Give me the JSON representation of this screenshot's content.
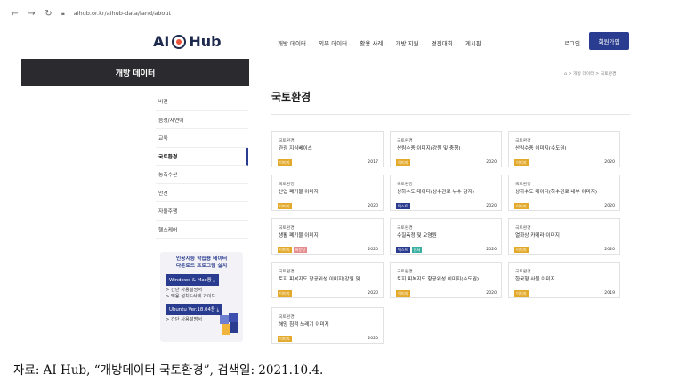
{
  "browser": {
    "url": "aihub.or.kr/aihub-data/land/about"
  },
  "header": {
    "logo_ai": "AI",
    "logo_hub": "Hub",
    "menu": [
      "개방 데이터",
      "외부 데이터",
      "활용 사례",
      "개방 지원",
      "경진대회",
      "게시판"
    ],
    "login": "로그인",
    "signup": "회원가입"
  },
  "sidebar": {
    "title": "개방 데이터",
    "items": [
      "비전",
      "음성/자연어",
      "교육",
      "국토환경",
      "농축수산",
      "안전",
      "자율주행",
      "헬스케어"
    ],
    "active_index": 3
  },
  "promo": {
    "title1": "인공지능 학습용 데이터",
    "title2": "다운로드 프로그램 설치",
    "btn1": "Windows & Mac용",
    "link1": "> 간단 사용설명서",
    "link2": "> 맥용 설치&삭제 가이드",
    "btn2": "Ubuntu Ver.18.04용",
    "link3": "> 간단 사용설명서"
  },
  "breadcrumb": "> 개방 데이터 > 국토환경",
  "page_title": "국토환경",
  "colors": {
    "tag_image": "#e3a92b",
    "tag_text": "#2a3c8f",
    "tag_video": "#e58c8c",
    "tag_audio": "#3bb0a0",
    "accent": "#2a3c8f"
  },
  "cards": [
    {
      "category": "국토환경",
      "name": "관광 지식베이스",
      "tags": [
        [
          "이미지",
          "image"
        ]
      ],
      "year": "2017"
    },
    {
      "category": "국토환경",
      "name": "산림수종 이미지(강원 및 충청)",
      "tags": [
        [
          "이미지",
          "image"
        ]
      ],
      "year": "2020"
    },
    {
      "category": "국토환경",
      "name": "산림수종 이미지(수도권)",
      "tags": [
        [
          "이미지",
          "image"
        ]
      ],
      "year": "2020"
    },
    {
      "category": "국토환경",
      "name": "산업 폐기물 이미지",
      "tags": [
        [
          "이미지",
          "image"
        ]
      ],
      "year": "2020"
    },
    {
      "category": "국토환경",
      "name": "상하수도 데이터(상수관로 누수 감지)",
      "tags": [
        [
          "텍스트",
          "text"
        ]
      ],
      "year": "2020"
    },
    {
      "category": "국토환경",
      "name": "상하수도 데이터(하수관로 내부 이미지)",
      "tags": [
        [
          "이미지",
          "image"
        ]
      ],
      "year": "2020"
    },
    {
      "category": "국토환경",
      "name": "생활 폐기물 이미지",
      "tags": [
        [
          "이미지",
          "image"
        ],
        [
          "바운딩",
          "video"
        ]
      ],
      "year": "2020"
    },
    {
      "category": "국토환경",
      "name": "수질측정 및 오염원",
      "tags": [
        [
          "텍스트",
          "text"
        ],
        [
          "센서",
          "audio"
        ]
      ],
      "year": "2020"
    },
    {
      "category": "국토환경",
      "name": "열화상 카메라 이미지",
      "tags": [
        [
          "이미지",
          "image"
        ]
      ],
      "year": "2020"
    },
    {
      "category": "국토환경",
      "name": "토지 피복지도 항공위성 이미지(강원 및 ...",
      "tags": [
        [
          "이미지",
          "image"
        ]
      ],
      "year": "2020"
    },
    {
      "category": "국토환경",
      "name": "토지 피복지도 항공위성 이미지(수도권)",
      "tags": [
        [
          "이미지",
          "image"
        ]
      ],
      "year": "2020"
    },
    {
      "category": "국토환경",
      "name": "한국형 사물 이미지",
      "tags": [
        [
          "이미지",
          "image"
        ]
      ],
      "year": "2019"
    },
    {
      "category": "국토환경",
      "name": "해양 침적 쓰레기 이미지",
      "tags": [
        [
          "이미지",
          "image"
        ]
      ],
      "year": "2020"
    }
  ],
  "caption": "자료: AI Hub, “개방데이터 국토환경”, 검색일: 2021.10.4."
}
